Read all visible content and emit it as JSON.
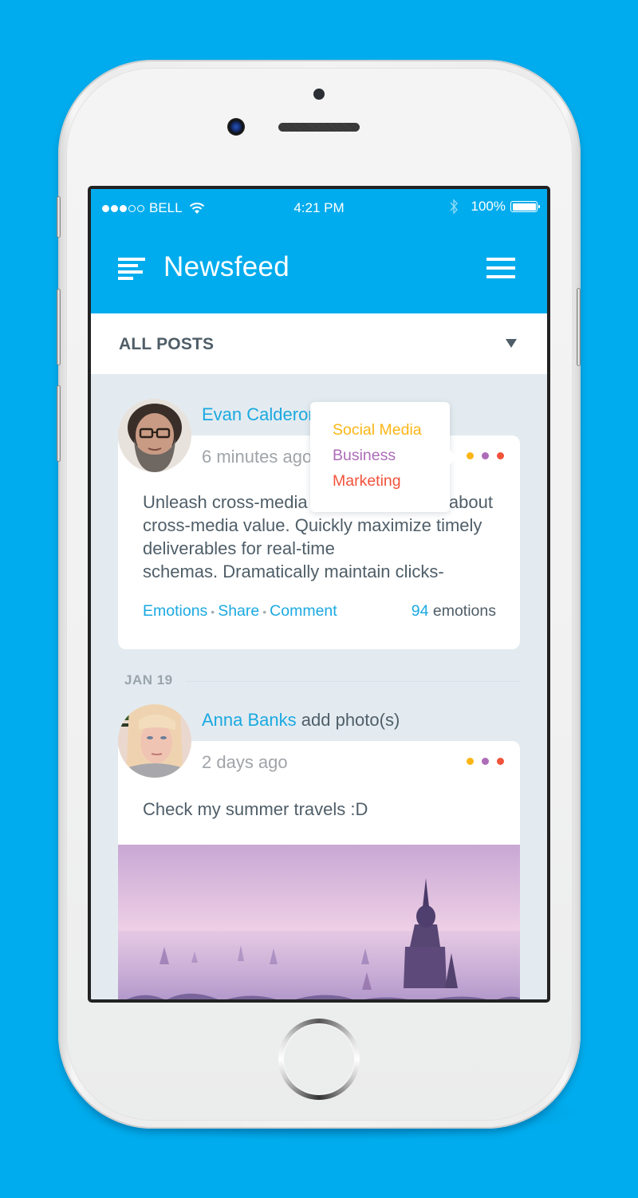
{
  "status_bar": {
    "carrier": "BELL",
    "signal_bars_filled": 3,
    "signal_bars_total": 5,
    "time": "4:21 PM",
    "battery": "100%",
    "battery_level": 1.0
  },
  "app_bar": {
    "title": "Newsfeed",
    "left_icon": "feed-lines-icon",
    "right_icon": "hamburger-menu-icon"
  },
  "filter": {
    "selected": "ALL POSTS"
  },
  "colors": {
    "brand": "#00aced",
    "link": "#1ba9e1",
    "text": "#4f5e68",
    "muted": "#a0a4a8",
    "feed_bg": "#e3ebf0",
    "dot_yellow": "#fbb616",
    "dot_purple": "#ad6cb8",
    "dot_red": "#f1533b"
  },
  "posts": [
    {
      "author": "Evan Calderon",
      "action": "",
      "time": "6 minutes ago",
      "body_lines": [
        "Unleash cross-media                             about",
        "cross-media value. Quickly maximize timely",
        "deliverables for real-time",
        "schemas. Dramatically maintain clicks-"
      ],
      "actions": [
        "Emotions",
        "Share",
        "Comment"
      ],
      "emotions_count": "94",
      "emotions_label": "emotions"
    },
    {
      "author": "Anna Banks",
      "action": "add photo(s)",
      "time": "2 days ago",
      "body": "Check my summer travels :D"
    }
  ],
  "date_separator": "JAN 19",
  "category_popup": {
    "items": [
      {
        "label": "Social Media",
        "color": "#fbb616"
      },
      {
        "label": "Business",
        "color": "#ad6cb8"
      },
      {
        "label": "Marketing",
        "color": "#f1533b"
      }
    ]
  }
}
